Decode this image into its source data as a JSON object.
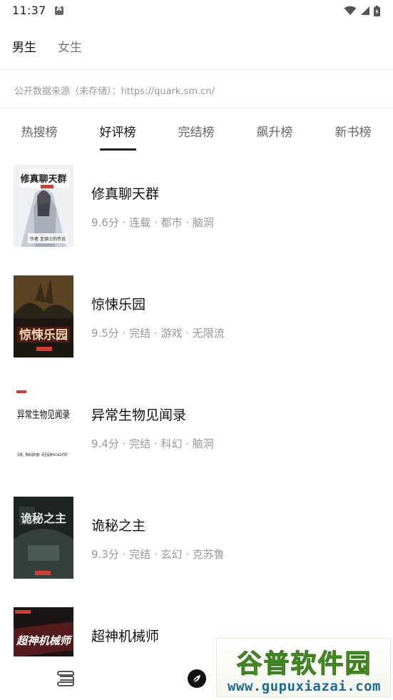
{
  "status_bar": {
    "time": "11:37"
  },
  "gender_tabs": [
    {
      "label": "男生",
      "selected": true
    },
    {
      "label": "女生",
      "selected": false
    }
  ],
  "source_line": "公开数据来源（未存储）：https://quark.sm.cn/",
  "rank_tabs": [
    {
      "label": "热搜榜",
      "active": false
    },
    {
      "label": "好评榜",
      "active": true
    },
    {
      "label": "完结榜",
      "active": false
    },
    {
      "label": "飙升榜",
      "active": false
    },
    {
      "label": "新书榜",
      "active": false
    }
  ],
  "books": [
    {
      "title": "修真聊天群",
      "meta": "9.6分 · 连载 · 都市 · 脑洞",
      "cover": {
        "bg": "#eef0f3",
        "accent": "#9aa0ad",
        "text": "修真聊天群",
        "text_color": "#222222",
        "sub": "作者 圣骑士的传说"
      }
    },
    {
      "title": "惊悚乐园",
      "meta": "9.5分 · 完结 · 游戏 · 无限流",
      "cover": {
        "bg": "#2b2418",
        "accent": "#7a5b2a",
        "text": "惊悚乐园",
        "text_color": "#e8d6b0",
        "sub": ""
      }
    },
    {
      "title": "异常生物见闻录",
      "meta": "9.4分 · 完结 · 科幻 · 脑洞",
      "cover": {
        "bg": "#ffffff",
        "accent": "#dddddd",
        "text": "异常生物见闻录",
        "text_color": "#111111",
        "sub": "没错，我就是封面！而且是用WORD打的！"
      }
    },
    {
      "title": "诡秘之主",
      "meta": "9.3分 · 完结 · 玄幻 · 克苏鲁",
      "cover": {
        "bg": "#1e2422",
        "accent": "#4a5a55",
        "text": "诡秘之主",
        "text_color": "#e6e6e6",
        "sub": ""
      }
    },
    {
      "title": "超神机械师",
      "meta": "",
      "cover": {
        "bg": "#1a1414",
        "accent": "#7a1f1f",
        "text": "超神机械师",
        "text_color": "#ffffff",
        "sub": ""
      }
    }
  ],
  "watermark": {
    "line1": "谷普软件园",
    "line2": "www.gupuxiazai.com"
  },
  "colors": {
    "active_text": "#111111",
    "inactive_text": "#666666",
    "meta_text": "#999999",
    "divider": "#eeeeee"
  }
}
